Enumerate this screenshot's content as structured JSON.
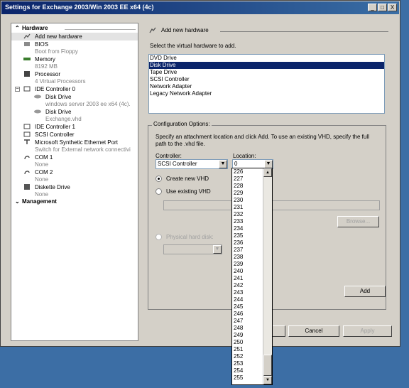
{
  "window": {
    "title": "Settings for Exchange 2003/Win 2003 EE x64 (4c)",
    "controls": [
      "_",
      "□",
      "X"
    ]
  },
  "tree": {
    "hardware_label": "Hardware",
    "management_label": "Management",
    "items": [
      {
        "main": "Add new hardware",
        "sub": "",
        "icon": "add-hardware-icon"
      },
      {
        "main": "BIOS",
        "sub": "Boot from Floppy",
        "icon": "bios-icon"
      },
      {
        "main": "Memory",
        "sub": "8192 MB",
        "icon": "memory-icon"
      },
      {
        "main": "Processor",
        "sub": "4 Virtual Processors",
        "icon": "processor-icon"
      },
      {
        "main": "IDE Controller 0",
        "sub": "",
        "icon": "ide-controller-icon"
      },
      {
        "main": "Disk Drive",
        "sub": "windows server 2003 ee x64 (4c).",
        "icon": "disk-drive-icon"
      },
      {
        "main": "Disk Drive",
        "sub": "Exchange.vhd",
        "icon": "disk-drive-icon"
      },
      {
        "main": "IDE Controller 1",
        "sub": "",
        "icon": "ide-controller-icon"
      },
      {
        "main": "SCSI Controller",
        "sub": "",
        "icon": "scsi-controller-icon"
      },
      {
        "main": "Microsoft Synthetic Ethernet Port",
        "sub": "Switch for External network connectivi",
        "icon": "network-adapter-icon"
      },
      {
        "main": "COM 1",
        "sub": "None",
        "icon": "com-port-icon"
      },
      {
        "main": "COM 2",
        "sub": "None",
        "icon": "com-port-icon"
      },
      {
        "main": "Diskette Drive",
        "sub": "None",
        "icon": "diskette-drive-icon"
      }
    ]
  },
  "pane": {
    "heading": "Add new hardware",
    "select_label": "Select the virtual hardware to add.",
    "hardware_options": [
      "DVD Drive",
      "Disk Drive",
      "Tape Drive",
      "SCSI Controller",
      "Network Adapter",
      "Legacy Network Adapter"
    ],
    "selected_hardware": "Disk Drive",
    "config_title": "Configuration Options:",
    "config_desc": "Specify an attachment location and click Add. To use an existing VHD, specify the full path to the .vhd file.",
    "controller_label": "Controller:",
    "controller_value": "SCSI Controller",
    "location_label": "Location:",
    "location_value": "0",
    "radio_new": "Create new VHD",
    "radio_existing": "Use existing VHD",
    "radio_physical": "Physical hard disk:",
    "browse_label": "Browse...",
    "add_label": "Add"
  },
  "footer": {
    "cancel_label": "Cancel",
    "apply_label": "Apply"
  },
  "location_dropdown": [
    "226",
    "227",
    "228",
    "229",
    "230",
    "231",
    "232",
    "233",
    "234",
    "235",
    "236",
    "237",
    "238",
    "239",
    "240",
    "241",
    "242",
    "243",
    "244",
    "245",
    "246",
    "247",
    "248",
    "249",
    "250",
    "251",
    "252",
    "253",
    "254",
    "255"
  ]
}
